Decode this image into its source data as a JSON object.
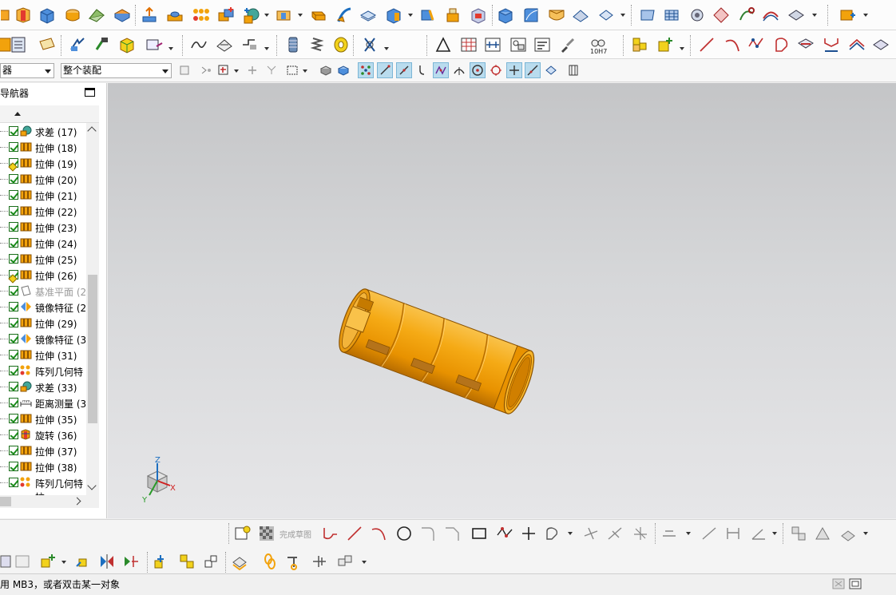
{
  "selection_bar": {
    "filter_value": "器",
    "scope_value": "整个装配"
  },
  "navigator": {
    "title": "导航器",
    "partial_last_item": "拉",
    "items": [
      {
        "label": "求差 (17)",
        "icon": "subtract-icon",
        "dim": false,
        "warn": false
      },
      {
        "label": "拉伸 (18)",
        "icon": "extrude-icon",
        "dim": false,
        "warn": false
      },
      {
        "label": "拉伸 (19)",
        "icon": "extrude-icon",
        "dim": false,
        "warn": true
      },
      {
        "label": "拉伸 (20)",
        "icon": "extrude-icon",
        "dim": false,
        "warn": false
      },
      {
        "label": "拉伸 (21)",
        "icon": "extrude-icon",
        "dim": false,
        "warn": false
      },
      {
        "label": "拉伸 (22)",
        "icon": "extrude-icon",
        "dim": false,
        "warn": false
      },
      {
        "label": "拉伸 (23)",
        "icon": "extrude-icon",
        "dim": false,
        "warn": false
      },
      {
        "label": "拉伸 (24)",
        "icon": "extrude-icon",
        "dim": false,
        "warn": false
      },
      {
        "label": "拉伸 (25)",
        "icon": "extrude-icon",
        "dim": false,
        "warn": false
      },
      {
        "label": "拉伸 (26)",
        "icon": "extrude-icon",
        "dim": false,
        "warn": true
      },
      {
        "label": "基准平面 (2",
        "icon": "datum-plane-icon",
        "dim": true,
        "warn": false
      },
      {
        "label": "镜像特征 (2",
        "icon": "mirror-feature-icon",
        "dim": false,
        "warn": false
      },
      {
        "label": "拉伸 (29)",
        "icon": "extrude-icon",
        "dim": false,
        "warn": false
      },
      {
        "label": "镜像特征 (3",
        "icon": "mirror-feature-icon",
        "dim": false,
        "warn": false
      },
      {
        "label": "拉伸 (31)",
        "icon": "extrude-icon",
        "dim": false,
        "warn": false
      },
      {
        "label": "阵列几何特",
        "icon": "pattern-geometry-icon",
        "dim": false,
        "warn": false
      },
      {
        "label": "求差 (33)",
        "icon": "subtract-icon",
        "dim": false,
        "warn": false
      },
      {
        "label": "距离测量 (3",
        "icon": "measure-distance-icon",
        "dim": false,
        "warn": false
      },
      {
        "label": "拉伸 (35)",
        "icon": "extrude-icon",
        "dim": false,
        "warn": false
      },
      {
        "label": "旋转 (36)",
        "icon": "revolve-icon",
        "dim": false,
        "warn": false
      },
      {
        "label": "拉伸 (37)",
        "icon": "extrude-icon",
        "dim": false,
        "warn": false
      },
      {
        "label": "拉伸 (38)",
        "icon": "extrude-icon",
        "dim": false,
        "warn": false
      },
      {
        "label": "阵列几何特",
        "icon": "pattern-geometry-icon",
        "dim": false,
        "warn": false
      }
    ]
  },
  "viewport": {
    "model": "orange-cylinder-part",
    "triad": {
      "x": "X",
      "y": "Y",
      "z": "Z"
    }
  },
  "bottom_toolbar": {
    "finish_sketch_label": "完成草图"
  },
  "toolbar2": {
    "fit_label": "10H7"
  },
  "status": {
    "text": "用 MB3，或者双击某一对象"
  },
  "colors": {
    "model_orange": "#f2a20c",
    "model_dark": "#b96f00",
    "slot_brown": "#b5731a",
    "selection_highlight": "#b9dcee"
  }
}
